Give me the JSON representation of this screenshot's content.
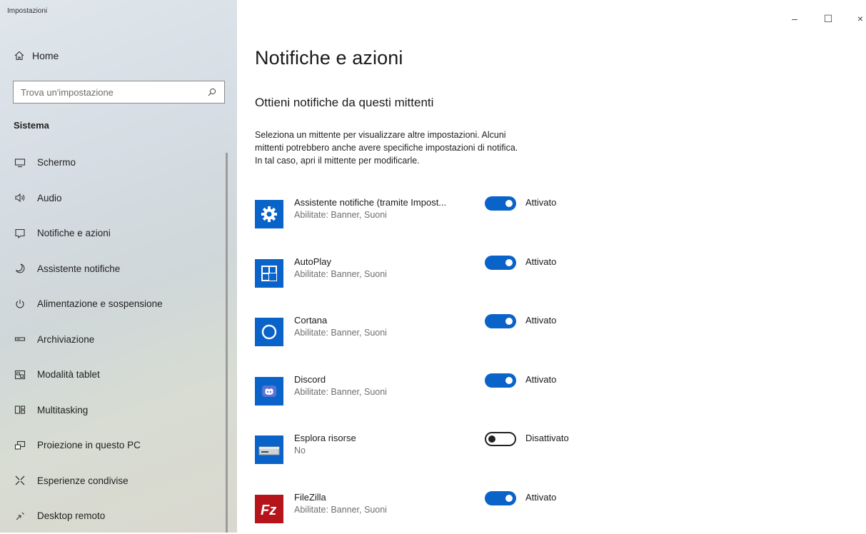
{
  "window": {
    "title": "Impostazioni",
    "controls": {
      "minimize": "–",
      "maximize": "☐",
      "close": "×"
    }
  },
  "sidebar": {
    "home_label": "Home",
    "search_placeholder": "Trova un'impostazione",
    "section_label": "Sistema",
    "items": [
      {
        "label": "Schermo",
        "icon": "monitor-icon"
      },
      {
        "label": "Audio",
        "icon": "speaker-icon"
      },
      {
        "label": "Notifiche e azioni",
        "icon": "notification-icon"
      },
      {
        "label": "Assistente notifiche",
        "icon": "moon-icon"
      },
      {
        "label": "Alimentazione e sospensione",
        "icon": "power-icon"
      },
      {
        "label": "Archiviazione",
        "icon": "storage-icon"
      },
      {
        "label": "Modalità tablet",
        "icon": "tablet-mode-icon"
      },
      {
        "label": "Multitasking",
        "icon": "multitasking-icon"
      },
      {
        "label": "Proiezione in questo PC",
        "icon": "projection-icon"
      },
      {
        "label": "Esperienze condivise",
        "icon": "shared-experiences-icon"
      },
      {
        "label": "Desktop remoto",
        "icon": "remote-desktop-icon"
      }
    ]
  },
  "main": {
    "title": "Notifiche e azioni",
    "subtitle": "Ottieni notifiche da questi mittenti",
    "description_lines": [
      "Seleziona un mittente per visualizzare altre impostazioni. Alcuni",
      "mittenti potrebbero anche avere specifiche impostazioni di notifica.",
      "In tal caso, apri il mittente per modificarle."
    ],
    "senders": [
      {
        "name": "Assistente notifiche (tramite Impost...",
        "status": "Abilitate: Banner, Suoni",
        "enabled": true,
        "toggle_label": "Attivato",
        "icon": "gear-icon",
        "icon_color": "#0a63c9"
      },
      {
        "name": "AutoPlay",
        "status": "Abilitate: Banner, Suoni",
        "enabled": true,
        "toggle_label": "Attivato",
        "icon": "autoplay-icon",
        "icon_color": "#0a63c9"
      },
      {
        "name": "Cortana",
        "status": "Abilitate: Banner, Suoni",
        "enabled": true,
        "toggle_label": "Attivato",
        "icon": "cortana-icon",
        "icon_color": "#0a63c9"
      },
      {
        "name": "Discord",
        "status": "Abilitate: Banner, Suoni",
        "enabled": true,
        "toggle_label": "Attivato",
        "icon": "discord-icon",
        "icon_color": "#0a63c9"
      },
      {
        "name": "Esplora risorse",
        "status": "No",
        "enabled": false,
        "toggle_label": "Disattivato",
        "icon": "drive-icon",
        "icon_color": "#0a63c9"
      },
      {
        "name": "FileZilla",
        "status": "Abilitate: Banner, Suoni",
        "enabled": true,
        "toggle_label": "Attivato",
        "icon": "filezilla-icon",
        "icon_color": "#b5141b"
      }
    ]
  },
  "colors": {
    "accent": "#0a63c9",
    "filezilla": "#b5141b"
  }
}
